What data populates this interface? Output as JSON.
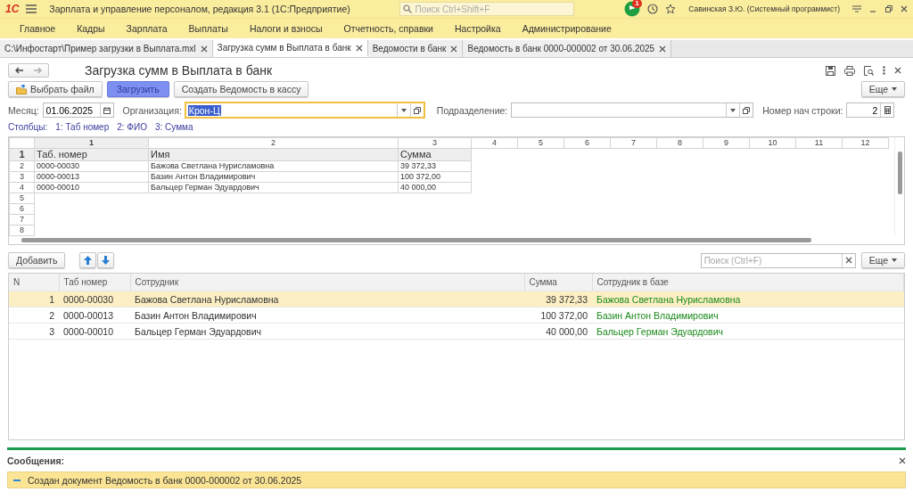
{
  "app": {
    "logo": "1С",
    "title": "Зарплата и управление персоналом, редакция 3.1  (1С:Предприятие)",
    "search_placeholder": "Поиск Ctrl+Shift+F",
    "notification_count": "1",
    "user": "Савинская З.Ю. (Системный программист)"
  },
  "menu": [
    "Главное",
    "Кадры",
    "Зарплата",
    "Выплаты",
    "Налоги и взносы",
    "Отчетность, справки",
    "Настройка",
    "Администрирование"
  ],
  "tabs": [
    {
      "label": "C:\\Инфостарт\\Пример загрузки в Выплата.mxl",
      "selected": false
    },
    {
      "label": "Загрузка сумм в Выплата в банк",
      "selected": true
    },
    {
      "label": "Ведомости в банк",
      "selected": false
    },
    {
      "label": "Ведомость в банк 0000-000002 от 30.06.2025",
      "selected": false
    }
  ],
  "form": {
    "title": "Загрузка сумм в Выплата в банк",
    "buttons": [
      {
        "label": "Выбрать файл",
        "kind": "file"
      },
      {
        "label": "Загрузить",
        "kind": "default"
      },
      {
        "label": "Создать Ведомость в кассу",
        "kind": "plain"
      }
    ],
    "more": "Еще",
    "month": {
      "label": "Месяц:",
      "value": "01.06.2025"
    },
    "organization": {
      "label": "Организация:",
      "value": "Крон-Ц"
    },
    "subdivision": {
      "label": "Подразделение:"
    },
    "start_row": {
      "label": "Номер нач строки:",
      "value": "2"
    },
    "columns_label": "Столбцы:",
    "columns": [
      "1: Таб номер",
      "2: ФИО",
      "3: Сумма"
    ]
  },
  "sheet": {
    "column_numbers": [
      "1",
      "2",
      "3",
      "4",
      "5",
      "6",
      "7",
      "8",
      "9",
      "10",
      "11",
      "12"
    ],
    "row_numbers": [
      "1",
      "2",
      "3",
      "4",
      "5",
      "6",
      "7",
      "8"
    ],
    "rows": [
      [
        "Таб. номер",
        "Имя",
        "Сумма"
      ],
      [
        "0000-00030",
        "Бажова Светлана Нурисламовна",
        "39 372,33"
      ],
      [
        "0000-00013",
        "Базин Антон Владимирович",
        "100 372,00"
      ],
      [
        "0000-00010",
        "Бальцер Герман Эдуардович",
        "40 000,00"
      ]
    ]
  },
  "table": {
    "add_button": "Добавить",
    "search_placeholder": "Поиск (Ctrl+F)",
    "more": "Еще",
    "columns": [
      "N",
      "Таб номер",
      "Сотрудник",
      "Сумма",
      "Сотрудник в базе"
    ],
    "rows": [
      {
        "cells": [
          "1",
          "0000-00030",
          "Бажова Светлана Нурисламовна",
          "39 372,33",
          "Бажова Светлана Нурисламовна"
        ],
        "selected": true
      },
      {
        "cells": [
          "2",
          "0000-00013",
          "Базин Антон Владимирович",
          "100 372,00",
          "Базин Антон Владимирович"
        ],
        "selected": false
      },
      {
        "cells": [
          "3",
          "0000-00010",
          "Бальцер Герман Эдуардович",
          "40 000,00",
          "Бальцер Герман Эдуардович"
        ],
        "selected": false
      }
    ]
  },
  "messages": {
    "title": "Сообщения:",
    "items": [
      "Создан документ Ведомость в банк 0000-000002 от 30.06.2025"
    ]
  }
}
